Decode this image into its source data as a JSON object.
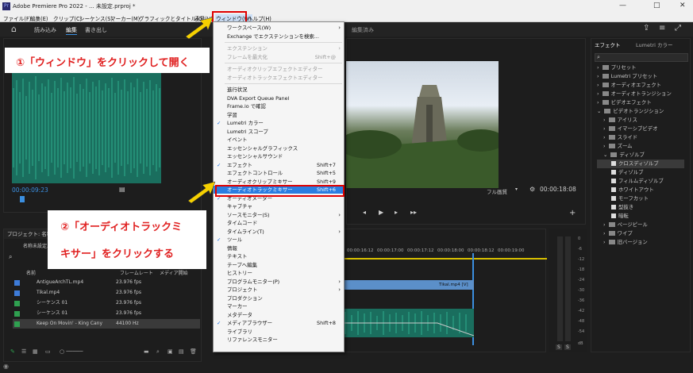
{
  "window": {
    "title": "Adobe Premiere Pro 2022 - ... 未設定.prproj *",
    "app_icon": "Pr",
    "minimize": "—",
    "maximize": "□",
    "close": "✕"
  },
  "menubar": {
    "items": [
      "ファイル(F)",
      "編集(E)",
      "クリップ(C)",
      "シーケンス(S)",
      "マーカー(M)",
      "グラフィックとタイトル(G)",
      "表示(V)",
      "ウィンドウ(W)",
      "ヘルプ(H)"
    ]
  },
  "workspaces": {
    "tabs": [
      "読み込み",
      "編集",
      "書き出し"
    ],
    "right_label": "編集済み"
  },
  "source_monitor": {
    "timecode": "00:00:09:23"
  },
  "program_monitor": {
    "timecode": "00:00:18:08",
    "zoom": "フル画質"
  },
  "project_panel": {
    "title": "プロジェクト: 名称",
    "file": "名称未設定.p",
    "columns": [
      "名前",
      "フレームレート",
      "メディア開始"
    ],
    "rows": [
      {
        "name": "AntigueArchTL.mp4",
        "fps": "23.976 fps",
        "color": "#3d7bd8"
      },
      {
        "name": "Tikal.mp4",
        "fps": "23.976 fps",
        "color": "#3d7bd8"
      },
      {
        "name": "シーケンス 01",
        "fps": "23.976 fps",
        "color": "#2fa050"
      },
      {
        "name": "シーケンス 01",
        "fps": "23.976 fps",
        "color": "#2fa050"
      },
      {
        "name": "Keep On Movin' - King Cany",
        "fps": "44100 Hz",
        "color": "#2fa050"
      }
    ]
  },
  "timeline": {
    "ticks": [
      "00:00:16:12",
      "00:00:17:00",
      "00:00:17:12",
      "00:00:18:00",
      "00:00:18:12",
      "00:00:19:00"
    ],
    "clip_label": "Tikal.mp4 [V]"
  },
  "vu": {
    "ticks": [
      "0",
      "-6",
      "-12",
      "-18",
      "-24",
      "-30",
      "-36",
      "-42",
      "-48",
      "-54",
      "dB"
    ],
    "solo": [
      "S",
      "S"
    ]
  },
  "effects_panel": {
    "tabs": [
      "エフェクト",
      "Lumetri カラー"
    ],
    "items": [
      {
        "label": "プリセット",
        "level": 0
      },
      {
        "label": "Lumetri プリセット",
        "level": 0
      },
      {
        "label": "オーディオエフェクト",
        "level": 0
      },
      {
        "label": "オーディオトランジション",
        "level": 0
      },
      {
        "label": "ビデオエフェクト",
        "level": 0
      },
      {
        "label": "ビデオトランジション",
        "level": 0
      },
      {
        "label": "アイリス",
        "level": 1
      },
      {
        "label": "イマーシブビデオ",
        "level": 1
      },
      {
        "label": "スライド",
        "level": 1
      },
      {
        "label": "ズーム",
        "level": 1
      },
      {
        "label": "ディゾルブ",
        "level": 1
      },
      {
        "label": "クロスディゾルブ",
        "level": 2
      },
      {
        "label": "ディゾルブ",
        "level": 2
      },
      {
        "label": "フィルムディゾルブ",
        "level": 2
      },
      {
        "label": "ホワイトアウト",
        "level": 2
      },
      {
        "label": "モーフカット",
        "level": 2
      },
      {
        "label": "型抜き",
        "level": 2
      },
      {
        "label": "暗転",
        "level": 2
      },
      {
        "label": "ページピール",
        "level": 1
      },
      {
        "label": "ワイプ",
        "level": 1
      },
      {
        "label": "旧バージョン",
        "level": 1
      }
    ]
  },
  "window_menu": {
    "items": [
      {
        "label": "ワークスペース(W)",
        "arrow": true
      },
      {
        "label": "Exchange でエクステンションを検索..."
      },
      {
        "sep": true
      },
      {
        "label": "エクステンション",
        "arrow": true,
        "disabled": true
      },
      {
        "label": "フレームを最大化",
        "shortcut": "Shift+@",
        "disabled": true
      },
      {
        "sep": true
      },
      {
        "label": "オーディオクリップエフェクトエディター",
        "disabled": true
      },
      {
        "label": "オーディオトラックエフェクトエディター",
        "disabled": true
      },
      {
        "sep": true
      },
      {
        "label": "進行状況"
      },
      {
        "label": "DVA Export Queue Panel"
      },
      {
        "label": "Frame.io で確認"
      },
      {
        "label": "学習"
      },
      {
        "label": "Lumetri カラー",
        "checked": true
      },
      {
        "label": "Lumetri スコープ"
      },
      {
        "label": "イベント"
      },
      {
        "label": "エッセンシャルグラフィックス"
      },
      {
        "label": "エッセンシャルサウンド"
      },
      {
        "label": "エフェクト",
        "shortcut": "Shift+7",
        "checked": true
      },
      {
        "label": "エフェクトコントロール",
        "shortcut": "Shift+5"
      },
      {
        "label": "オーディオクリップミキサー",
        "shortcut": "Shift+9"
      },
      {
        "label": "オーディオトラックミキサー",
        "shortcut": "Shift+6",
        "highlight": true
      },
      {
        "label": "オーディオメーター",
        "checked": true
      },
      {
        "label": "キャプチャ"
      },
      {
        "label": "ソースモニター(S)",
        "arrow": true
      },
      {
        "label": "タイムコード"
      },
      {
        "label": "タイムライン(T)",
        "arrow": true
      },
      {
        "label": "ツール",
        "checked": true
      },
      {
        "label": "情報"
      },
      {
        "label": "テキスト"
      },
      {
        "label": "テープへ編集"
      },
      {
        "label": "ヒストリー"
      },
      {
        "label": "プログラムモニター(P)",
        "arrow": true
      },
      {
        "label": "プロジェクト",
        "arrow": true
      },
      {
        "label": "プロダクション"
      },
      {
        "label": "マーカー"
      },
      {
        "label": "メタデータ"
      },
      {
        "label": "メディアブラウザー",
        "shortcut": "Shift+8",
        "checked": true
      },
      {
        "label": "ライブラリ"
      },
      {
        "label": "リファレンスモニター"
      }
    ]
  },
  "callouts": {
    "step1": "①「ウィンドウ」をクリックして開く",
    "step2_line1": "②「オーディオトラックミ",
    "step2_line2": "キサー」をクリックする"
  },
  "colors": {
    "accent_blue": "#2a7de1",
    "annotation_red": "#e00000",
    "arrow_yellow": "#f5d000",
    "waveform_green": "#1a6e5e"
  }
}
